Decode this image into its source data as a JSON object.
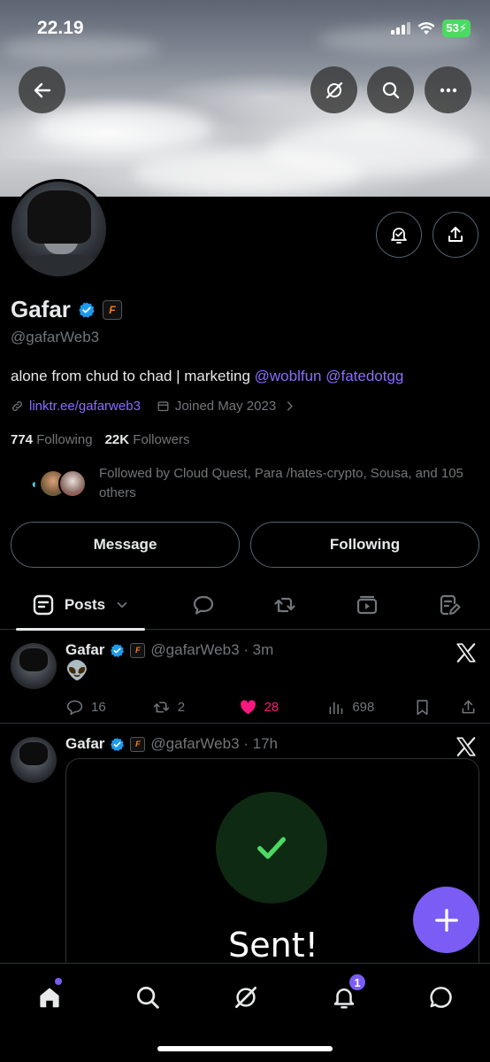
{
  "status_bar": {
    "time": "22.19",
    "battery": "53"
  },
  "header": {
    "back_icon": "arrow-left-icon",
    "grok_icon": "grok-icon",
    "search_icon": "search-icon",
    "more_icon": "more-horizontal-icon"
  },
  "profile": {
    "name": "Gafar",
    "affiliate_badge": "F",
    "handle": "@gafarWeb3",
    "bio_text": "alone from chud to chad | marketing ",
    "bio_mentions": [
      "@woblfun",
      "@fatedotgg"
    ],
    "link": "linktr.ee/gafarweb3",
    "joined": "Joined May 2023",
    "following_count": "774",
    "following_label": "Following",
    "followers_count": "22K",
    "followers_label": "Followers",
    "followed_by": "Followed by Cloud Quest, Para /hates-crypto, Sousa, and 105 others"
  },
  "buttons": {
    "message": "Message",
    "following": "Following"
  },
  "tabs": {
    "posts_label": "Posts"
  },
  "posts": [
    {
      "name": "Gafar",
      "handle_time": "@gafarWeb3 · 3m",
      "text": "👽",
      "replies": "16",
      "reposts": "2",
      "likes": "28",
      "views": "698"
    },
    {
      "name": "Gafar",
      "handle_time": "@gafarWeb3 · 17h",
      "card_text": "Sent!"
    }
  ],
  "bottom_nav": {
    "notifications_badge": "1"
  },
  "colors": {
    "accent": "#7b5cf5",
    "link": "#8c6cff",
    "like": "#f91880",
    "verified": "#1d9bf0",
    "muted": "#71767b"
  }
}
